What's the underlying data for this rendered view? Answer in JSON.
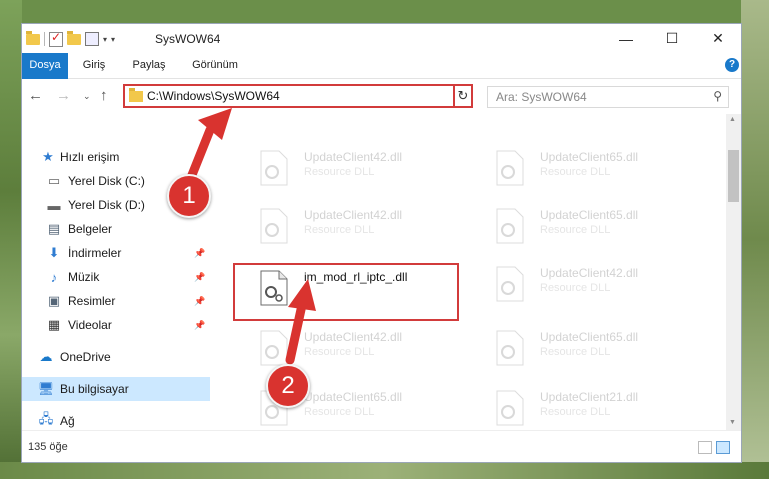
{
  "window": {
    "title": "SysWOW64"
  },
  "ribbon": {
    "tabs": [
      "Dosya",
      "Giriş",
      "Paylaş",
      "Görünüm"
    ]
  },
  "address": {
    "path": "C:\\Windows\\SysWOW64"
  },
  "search": {
    "placeholder": "Ara: SysWOW64"
  },
  "sidebar": {
    "items": [
      {
        "label": "Hızlı erişim",
        "icon": "star-icon"
      },
      {
        "label": "Yerel Disk (C:)",
        "icon": "drive-icon"
      },
      {
        "label": "Yerel Disk (D:)",
        "icon": "drive-icon"
      },
      {
        "label": "Belgeler",
        "icon": "documents-icon"
      },
      {
        "label": "İndirmeler",
        "icon": "download-icon"
      },
      {
        "label": "Müzik",
        "icon": "music-icon"
      },
      {
        "label": "Resimler",
        "icon": "pictures-icon"
      },
      {
        "label": "Videolar",
        "icon": "video-icon"
      },
      {
        "label": "OneDrive",
        "icon": "cloud-icon"
      },
      {
        "label": "Bu bilgisayar",
        "icon": "computer-icon"
      },
      {
        "label": "Ağ",
        "icon": "network-icon"
      }
    ]
  },
  "files": {
    "highlighted": {
      "name": "im_mod_rl_iptc_.dll"
    },
    "background": [
      {
        "name": "UpdateClient42.dll",
        "type": "Resource DLL"
      },
      {
        "name": "UpdateClient65.dll",
        "type": "Resource DLL"
      },
      {
        "name": "UpdateClient42.dll",
        "type": "Resource DLL"
      },
      {
        "name": "UpdateClient65.dll",
        "type": "Resource DLL"
      },
      {
        "name": "UpdateClient42.dll",
        "type": "Resource DLL"
      },
      {
        "name": "UpdateClient42.dll",
        "type": "Resource DLL"
      },
      {
        "name": "UpdateClient65.dll",
        "type": "Resource DLL"
      },
      {
        "name": "UpdateClient65.dll",
        "type": "Resource DLL"
      },
      {
        "name": "UpdateClient21.dll",
        "type": "Resource DLL"
      }
    ]
  },
  "status": {
    "count": "135 öğe"
  },
  "badges": {
    "one": "1",
    "two": "2"
  },
  "colors": {
    "accent": "#1979ca",
    "highlight": "#d23b3b",
    "selected": "#cce8ff"
  }
}
